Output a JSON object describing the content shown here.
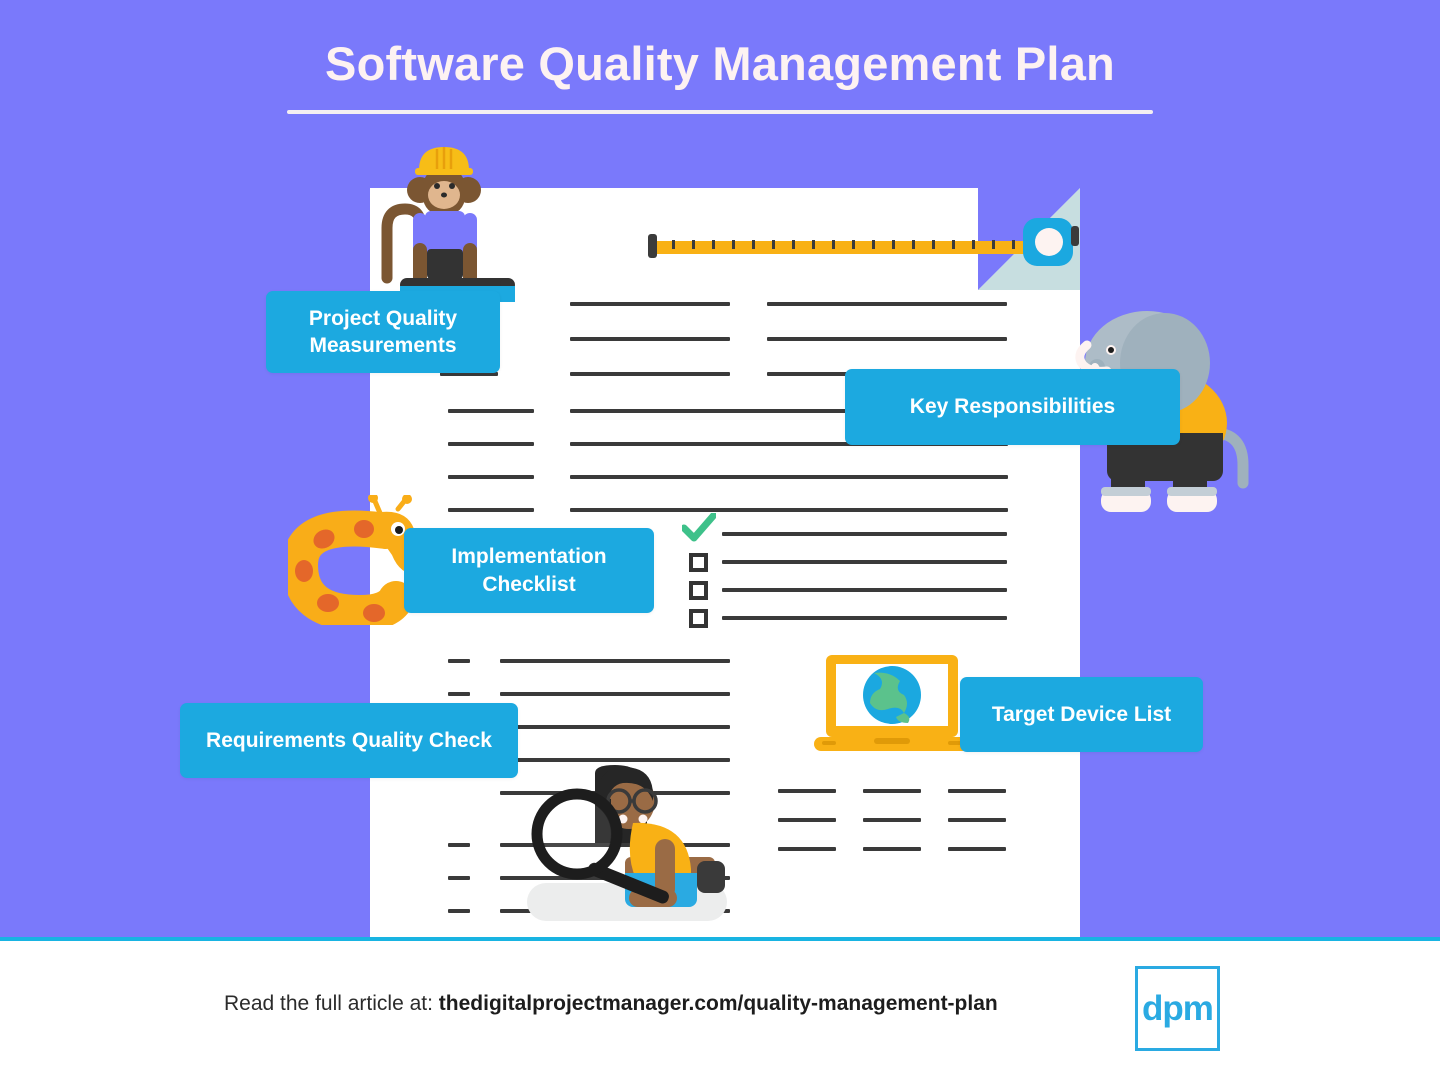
{
  "page": {
    "title": "Software Quality Management Plan",
    "background_color": "#7a79fb",
    "accent_color": "#1ca9e0",
    "document_color": "#ffffff"
  },
  "labels": [
    {
      "id": "project-quality-measurements",
      "text": "Project Quality\nMeasurements",
      "line1": "Project Quality",
      "line2": "Measurements"
    },
    {
      "id": "key-responsibilities",
      "text": "Key Responsibilities"
    },
    {
      "id": "implementation-checklist",
      "line1": "Implementation",
      "line2": "Checklist"
    },
    {
      "id": "requirements-quality-check",
      "text": "Requirements Quality Check"
    },
    {
      "id": "target-device-list",
      "text": "Target Device List"
    }
  ],
  "checklist": {
    "checked_color": "#3ec18a",
    "items": [
      {
        "state": "checked"
      },
      {
        "state": "unchecked"
      },
      {
        "state": "unchecked"
      },
      {
        "state": "unchecked"
      }
    ]
  },
  "illustrations": [
    {
      "name": "monkey-construction-worker",
      "hat_color": "#f7bd17",
      "shirt_color": "#7a79fb",
      "fur_color": "#7b5632"
    },
    {
      "name": "measuring-tape",
      "tape_color": "#f9b115",
      "case_color": "#1ba8e0"
    },
    {
      "name": "elephant",
      "body_color": "#9fb1bd",
      "shirt_color": "#f9b115",
      "shorts_color": "#333333"
    },
    {
      "name": "giraffe",
      "body_color": "#f9ad18",
      "spot_color": "#e4672a"
    },
    {
      "name": "laptop-globe",
      "frame_color": "#f9b115",
      "globe_ocean": "#1ba8e0",
      "globe_land": "#5bc28c"
    },
    {
      "name": "person-magnifying-glass",
      "shirt_color": "#f9b115",
      "shorts_color": "#2aaae2",
      "hair_color": "#262626",
      "skin_color": "#9a6b45"
    }
  ],
  "footer": {
    "prefix": "Read the full article at: ",
    "url": "thedigitalprojectmanager.com/quality-management-plan",
    "logo_text": "dpm",
    "logo_color": "#2aaae2",
    "divider_color": "#18b4e2"
  }
}
